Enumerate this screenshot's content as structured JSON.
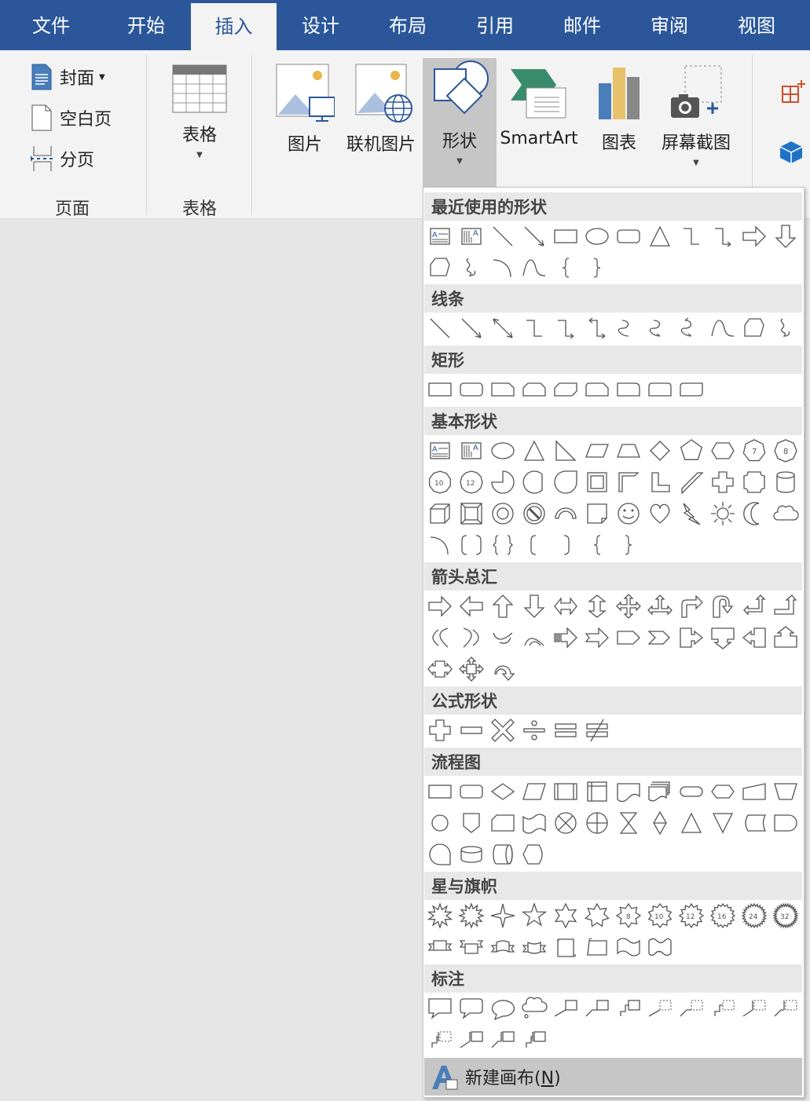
{
  "tabs": [
    {
      "label": "文件",
      "active": false
    },
    {
      "label": "开始",
      "active": false
    },
    {
      "label": "插入",
      "active": true
    },
    {
      "label": "设计",
      "active": false
    },
    {
      "label": "布局",
      "active": false
    },
    {
      "label": "引用",
      "active": false
    },
    {
      "label": "邮件",
      "active": false
    },
    {
      "label": "审阅",
      "active": false
    },
    {
      "label": "视图",
      "active": false
    }
  ],
  "ribbon": {
    "pages_group": {
      "label": "页面",
      "cover": "封面",
      "blank_page": "空白页",
      "page_break": "分页"
    },
    "tables_group": {
      "label": "表格",
      "table": "表格"
    },
    "illustrations": {
      "picture": "图片",
      "online_picture": "联机图片",
      "shapes": "形状",
      "smartart": "SmartArt",
      "chart": "图表",
      "screenshot": "屏幕截图"
    }
  },
  "gallery": {
    "sections": [
      {
        "title": "最近使用的形状",
        "shapes": [
          "text-box",
          "vertical-text-box",
          "line",
          "arrow-line",
          "rectangle",
          "oval",
          "rounded-rectangle",
          "triangle",
          "elbow-connector",
          "elbow-arrow-connector",
          "right-arrow",
          "down-arrow",
          "freeform",
          "scribble",
          "arc",
          "curve",
          "left-brace",
          "right-brace"
        ]
      },
      {
        "title": "线条",
        "shapes": [
          "line",
          "arrow-line",
          "double-arrow-line",
          "elbow-connector",
          "elbow-arrow-connector",
          "elbow-double-arrow-connector",
          "curved-connector",
          "curved-arrow-connector",
          "curved-double-arrow-connector",
          "curve",
          "freeform",
          "scribble"
        ]
      },
      {
        "title": "矩形",
        "shapes": [
          "rectangle",
          "rounded-rectangle",
          "snip-single-corner",
          "snip-same-side",
          "snip-diagonal",
          "snip-round-single",
          "round-single-corner",
          "round-same-side",
          "round-diagonal"
        ]
      },
      {
        "title": "基本形状",
        "shapes": [
          "text-box",
          "vertical-text-box",
          "oval",
          "isosceles-triangle",
          "right-triangle",
          "parallelogram",
          "trapezoid",
          "diamond",
          "pentagon",
          "hexagon",
          "heptagon",
          "octagon",
          "decagon",
          "dodecagon",
          "pie",
          "chord",
          "teardrop",
          "frame",
          "half-frame",
          "l-shape",
          "diagonal-stripe",
          "cross",
          "plaque",
          "can",
          "cube",
          "bevel",
          "donut",
          "no-symbol",
          "block-arc",
          "folded-corner",
          "smiley-face",
          "heart",
          "lightning-bolt",
          "sun",
          "moon",
          "cloud",
          "arc",
          "double-bracket",
          "double-brace",
          "left-bracket",
          "right-bracket",
          "left-brace",
          "right-brace"
        ]
      },
      {
        "title": "箭头总汇",
        "shapes": [
          "right-arrow",
          "left-arrow",
          "up-arrow",
          "down-arrow",
          "left-right-arrow",
          "up-down-arrow",
          "quad-arrow",
          "left-right-up-arrow",
          "bent-arrow",
          "u-turn-arrow",
          "left-up-arrow",
          "bent-up-arrow",
          "curved-right-arrow",
          "curved-left-arrow",
          "curved-up-arrow",
          "curved-down-arrow",
          "striped-right-arrow",
          "notched-right-arrow",
          "pentagon-arrow",
          "chevron",
          "right-arrow-callout",
          "down-arrow-callout",
          "left-arrow-callout",
          "up-arrow-callout",
          "left-right-arrow-callout",
          "quad-arrow-callout",
          "circular-arrow"
        ]
      },
      {
        "title": "公式形状",
        "shapes": [
          "plus",
          "minus",
          "multiply",
          "division",
          "equal",
          "not-equal"
        ]
      },
      {
        "title": "流程图",
        "shapes": [
          "process",
          "alternate-process",
          "decision",
          "data",
          "predefined-process",
          "internal-storage",
          "document",
          "multidocument",
          "terminator",
          "preparation",
          "manual-input",
          "manual-operation",
          "connector",
          "off-page-connector",
          "card",
          "punched-tape",
          "summing-junction",
          "or",
          "collate",
          "sort",
          "extract",
          "merge",
          "stored-data",
          "delay",
          "sequential-access-storage",
          "magnetic-disk",
          "direct-access-storage",
          "display"
        ]
      },
      {
        "title": "星与旗帜",
        "shapes": [
          "explosion-1",
          "explosion-2",
          "star-4",
          "star-5",
          "star-6",
          "star-7",
          "star-8",
          "star-10",
          "star-12",
          "star-16",
          "star-24",
          "star-32",
          "ribbon-up",
          "ribbon-down",
          "curved-ribbon-up",
          "curved-ribbon-down",
          "vertical-scroll",
          "horizontal-scroll",
          "wave",
          "double-wave"
        ]
      },
      {
        "title": "标注",
        "shapes": [
          "rectangular-callout",
          "rounded-rectangular-callout",
          "oval-callout",
          "cloud-callout",
          "line-callout-1",
          "line-callout-2",
          "line-callout-3",
          "line-callout-1-no-border",
          "line-callout-2-no-border",
          "line-callout-3-no-border",
          "line-callout-1-accent",
          "line-callout-2-accent",
          "line-callout-3-accent",
          "line-callout-1-border-accent",
          "line-callout-2-border-accent",
          "line-callout-3-border-accent"
        ]
      }
    ],
    "new_canvas_label": "新建画布(",
    "new_canvas_key": "N",
    "new_canvas_close": ")"
  }
}
